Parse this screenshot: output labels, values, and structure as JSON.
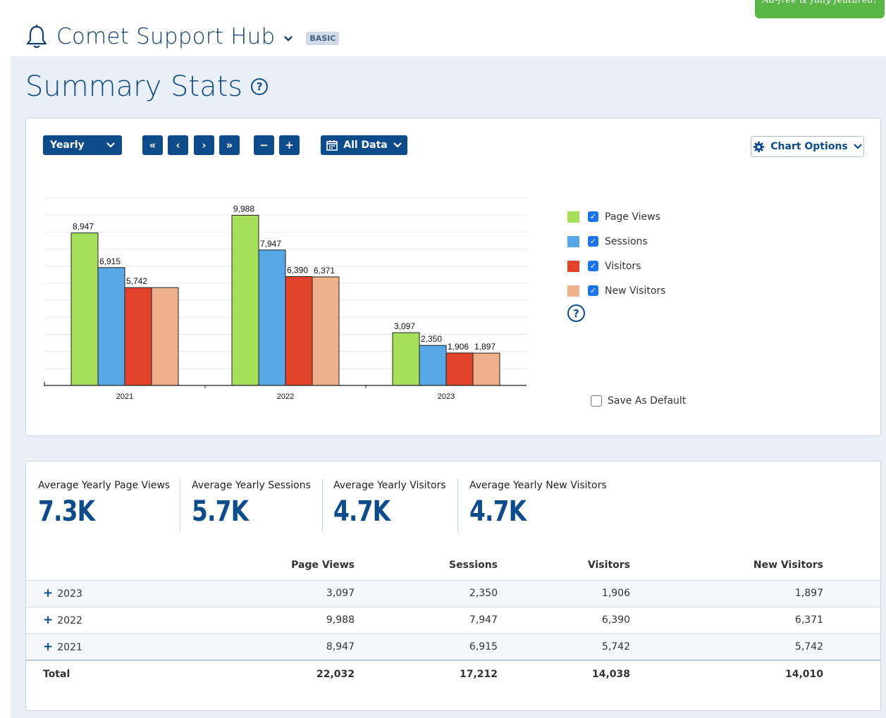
{
  "promo": {
    "text": "Ad-free & fully featured!"
  },
  "header": {
    "site_name": "Comet Support Hub",
    "plan_badge": "BASIC"
  },
  "page": {
    "title": "Summary Stats"
  },
  "controls": {
    "period_select": "Yearly",
    "nav_first": "«",
    "nav_prev": "‹",
    "nav_next": "›",
    "nav_last": "»",
    "zoom_out": "−",
    "zoom_in": "+",
    "date_range": "All Data",
    "chart_options": "Chart Options"
  },
  "legend": {
    "items": [
      {
        "label": "Page Views",
        "color": "#a6e05a",
        "checked": true
      },
      {
        "label": "Sessions",
        "color": "#58a7e6",
        "checked": true
      },
      {
        "label": "Visitors",
        "color": "#e0432a",
        "checked": true
      },
      {
        "label": "New Visitors",
        "color": "#f0b08c",
        "checked": true
      }
    ],
    "save_default": "Save As Default"
  },
  "chart_data": {
    "type": "bar",
    "categories": [
      "2021",
      "2022",
      "2023"
    ],
    "series": [
      {
        "name": "Page Views",
        "values": [
          8947,
          9988,
          3097
        ]
      },
      {
        "name": "Sessions",
        "values": [
          6915,
          7947,
          2350
        ]
      },
      {
        "name": "Visitors",
        "values": [
          5742,
          6390,
          1906
        ]
      },
      {
        "name": "New Visitors",
        "values": [
          5742,
          6371,
          1897
        ]
      }
    ],
    "value_labels": [
      [
        "8,947",
        "6,915",
        "5,742",
        ""
      ],
      [
        "9,988",
        "7,947",
        "6,390",
        "6,371"
      ],
      [
        "3,097",
        "2,350",
        "1,906",
        "1,897"
      ]
    ],
    "ylim": [
      0,
      11000
    ],
    "grid": true,
    "colors": [
      "#a6e05a",
      "#58a7e6",
      "#e0432a",
      "#f0b08c"
    ]
  },
  "kpis": [
    {
      "label": "Average Yearly Page Views",
      "value": "7.3K"
    },
    {
      "label": "Average Yearly Sessions",
      "value": "5.7K"
    },
    {
      "label": "Average Yearly Visitors",
      "value": "4.7K"
    },
    {
      "label": "Average Yearly New Visitors",
      "value": "4.7K"
    }
  ],
  "table": {
    "headers": [
      "",
      "Page Views",
      "Sessions",
      "Visitors",
      "New Visitors"
    ],
    "rows": [
      {
        "year": "2023",
        "page_views": "3,097",
        "sessions": "2,350",
        "visitors": "1,906",
        "new_visitors": "1,897"
      },
      {
        "year": "2022",
        "page_views": "9,988",
        "sessions": "7,947",
        "visitors": "6,390",
        "new_visitors": "6,371"
      },
      {
        "year": "2021",
        "page_views": "8,947",
        "sessions": "6,915",
        "visitors": "5,742",
        "new_visitors": "5,742"
      }
    ],
    "total": {
      "label": "Total",
      "page_views": "22,032",
      "sessions": "17,212",
      "visitors": "14,038",
      "new_visitors": "14,010"
    }
  }
}
